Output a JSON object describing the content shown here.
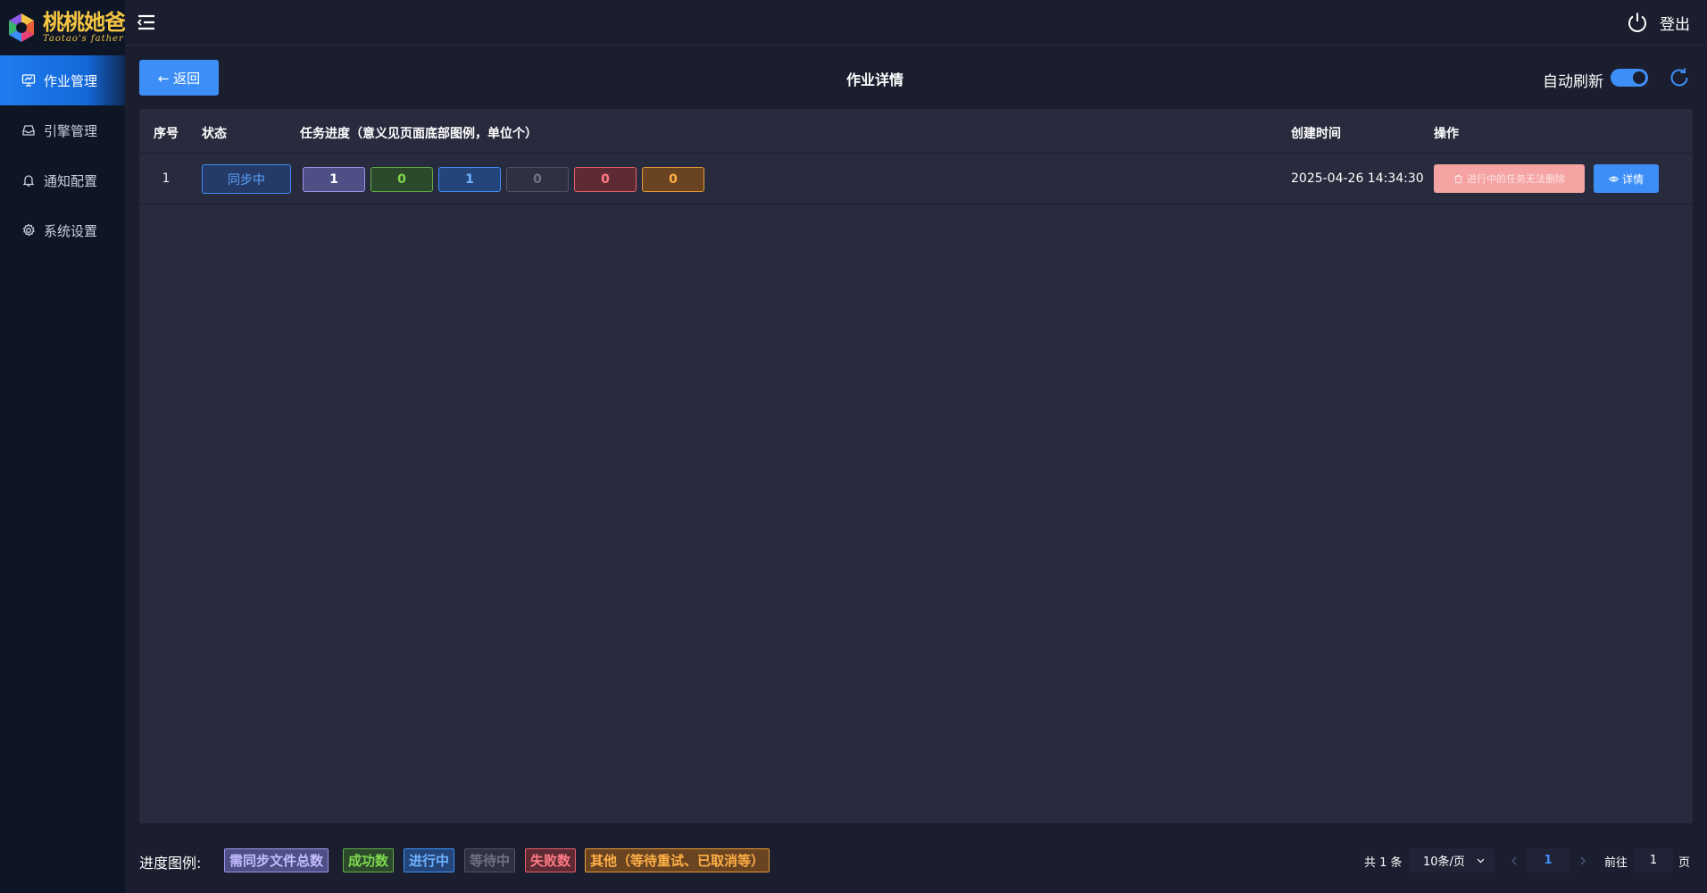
{
  "app": {
    "logo_cn": "桃桃她爸",
    "logo_en": "Taotao's father"
  },
  "sidebar": {
    "items": [
      {
        "label": "作业管理",
        "icon": "monitor-icon",
        "active": true
      },
      {
        "label": "引擎管理",
        "icon": "inbox-icon",
        "active": false
      },
      {
        "label": "通知配置",
        "icon": "bell-icon",
        "active": false
      },
      {
        "label": "系统设置",
        "icon": "gear-icon",
        "active": false
      }
    ]
  },
  "header": {
    "logout_label": "登出"
  },
  "toolbar": {
    "back_label": "← 返回",
    "title": "作业详情",
    "auto_refresh_label": "自动刷新",
    "auto_refresh_on": true
  },
  "table": {
    "headers": {
      "index": "序号",
      "status": "状态",
      "progress": "任务进度（意义见页面底部图例，单位个）",
      "created": "创建时间",
      "actions": "操作"
    },
    "rows": [
      {
        "index": "1",
        "status": "同步中",
        "progress": {
          "total": "1",
          "success": "0",
          "running": "1",
          "waiting": "0",
          "failed": "0",
          "other": "0"
        },
        "created": "2025-04-26 14:34:30",
        "delete_label": "进行中的任务无法删除",
        "detail_label": "详情"
      }
    ]
  },
  "legend": {
    "label": "进度图例:",
    "items": {
      "total": "需同步文件总数",
      "success": "成功数",
      "running": "进行中",
      "waiting": "等待中",
      "failed": "失败数",
      "other": "其他（等待重试、已取消等）"
    }
  },
  "pagination": {
    "total": "共 1 条",
    "page_size": "10条/页",
    "current_page": "1",
    "goto_label": "前往",
    "goto_value": "1",
    "goto_suffix": "页"
  },
  "colors": {
    "accent": "#3d8ff7",
    "sidebar_bg": "#0e1626",
    "panel_bg": "#282b3d",
    "page_bg": "#1b1e2e"
  }
}
